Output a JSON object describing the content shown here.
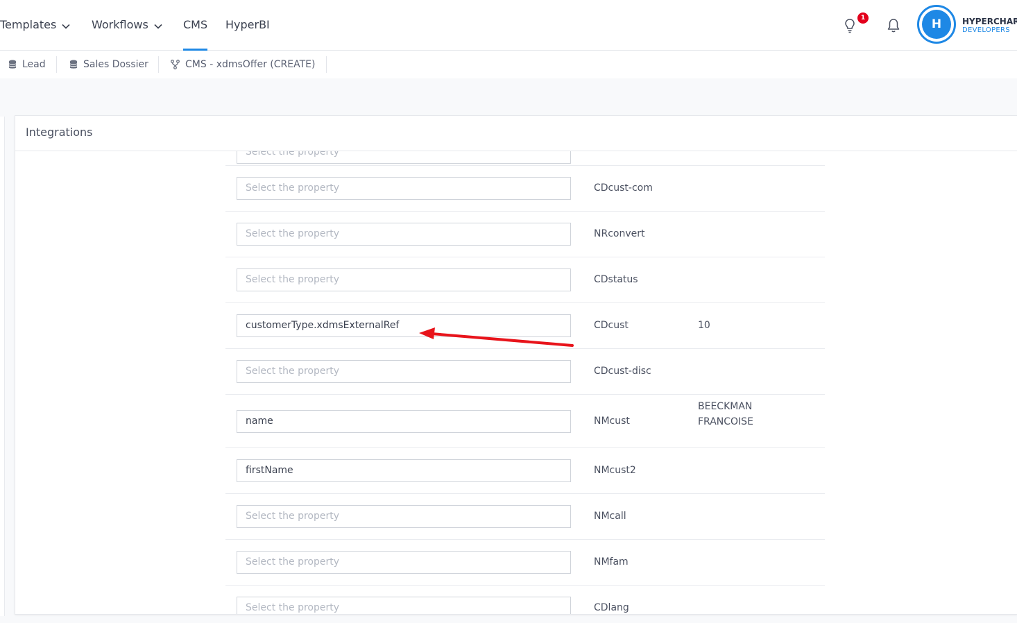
{
  "nav": {
    "items": [
      {
        "label": "Templates",
        "dropdown": true
      },
      {
        "label": "Workflows",
        "dropdown": true
      },
      {
        "label": "CMS",
        "active": true
      },
      {
        "label": "HyperBI"
      }
    ],
    "notification_count": "1",
    "user": {
      "initial": "H",
      "company": "HYPERCHAR",
      "subtitle": "DEVELOPERS"
    }
  },
  "breadcrumbs": [
    {
      "label": "Lead",
      "icon": "database-icon"
    },
    {
      "label": "Sales Dossier",
      "icon": "database-icon"
    },
    {
      "label": "CMS - xdmsOffer (CREATE)",
      "icon": "fork-icon"
    }
  ],
  "panel": {
    "title": "Integrations",
    "placeholder": "Select the property",
    "rows": [
      {
        "field": "",
        "name": "",
        "value": ""
      },
      {
        "field": "",
        "name": "CDcust-com",
        "value": ""
      },
      {
        "field": "",
        "name": "NRconvert",
        "value": ""
      },
      {
        "field": "",
        "name": "CDstatus",
        "value": ""
      },
      {
        "field": "customerType.xdmsExternalRef",
        "name": "CDcust",
        "value": "10"
      },
      {
        "field": "",
        "name": "CDcust-disc",
        "value": ""
      },
      {
        "field": "name",
        "name": "NMcust",
        "value": "BEECKMAN\nFRANCOISE"
      },
      {
        "field": "firstName",
        "name": "NMcust2",
        "value": ""
      },
      {
        "field": "",
        "name": "NMcall",
        "value": ""
      },
      {
        "field": "",
        "name": "NMfam",
        "value": ""
      },
      {
        "field": "",
        "name": "CDlang",
        "value": ""
      }
    ]
  },
  "colors": {
    "accent": "#1e88e5",
    "badge": "#e3001b",
    "annotation_arrow": "#e8141b"
  }
}
